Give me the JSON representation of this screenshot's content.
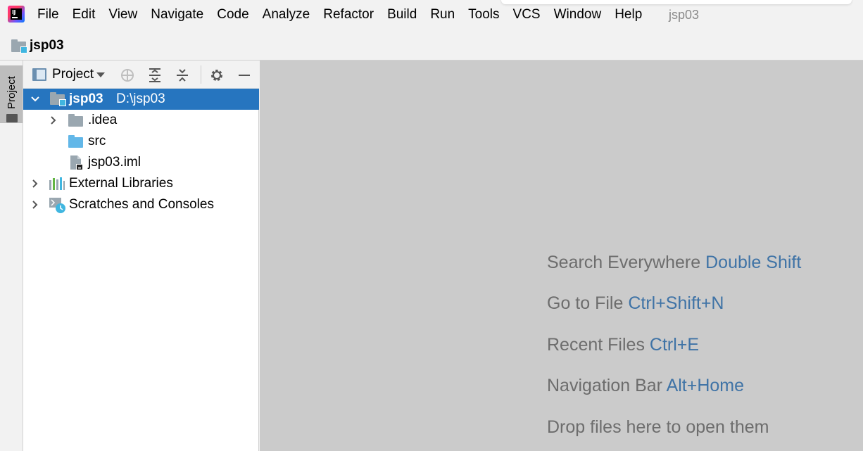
{
  "menu": {
    "items": [
      "File",
      "Edit",
      "View",
      "Navigate",
      "Code",
      "Analyze",
      "Refactor",
      "Build",
      "Run",
      "Tools",
      "VCS",
      "Window",
      "Help"
    ],
    "window_title": "jsp03"
  },
  "navbar": {
    "project": "jsp03"
  },
  "stripe": {
    "project_tab": "Project"
  },
  "project_panel": {
    "view_selector": "Project",
    "tree": {
      "root": {
        "name": "jsp03",
        "path": "D:\\jsp03"
      },
      "idea": ".idea",
      "src": "src",
      "iml": "jsp03.iml",
      "external_libraries": "External Libraries",
      "scratches": "Scratches and Consoles"
    }
  },
  "editor": {
    "hints": [
      {
        "text": "Search Everywhere",
        "key": "Double Shift"
      },
      {
        "text": "Go to File",
        "key": "Ctrl+Shift+N"
      },
      {
        "text": "Recent Files",
        "key": "Ctrl+E"
      },
      {
        "text": "Navigation Bar",
        "key": "Alt+Home"
      },
      {
        "text": "Drop files here to open them",
        "key": ""
      }
    ]
  },
  "colors": {
    "selection": "#2675bf",
    "shortcut": "#3f73a6",
    "editor_background": "#cbcbcb",
    "folder": "#9aa7b0",
    "source_folder": "#62b7e8"
  }
}
